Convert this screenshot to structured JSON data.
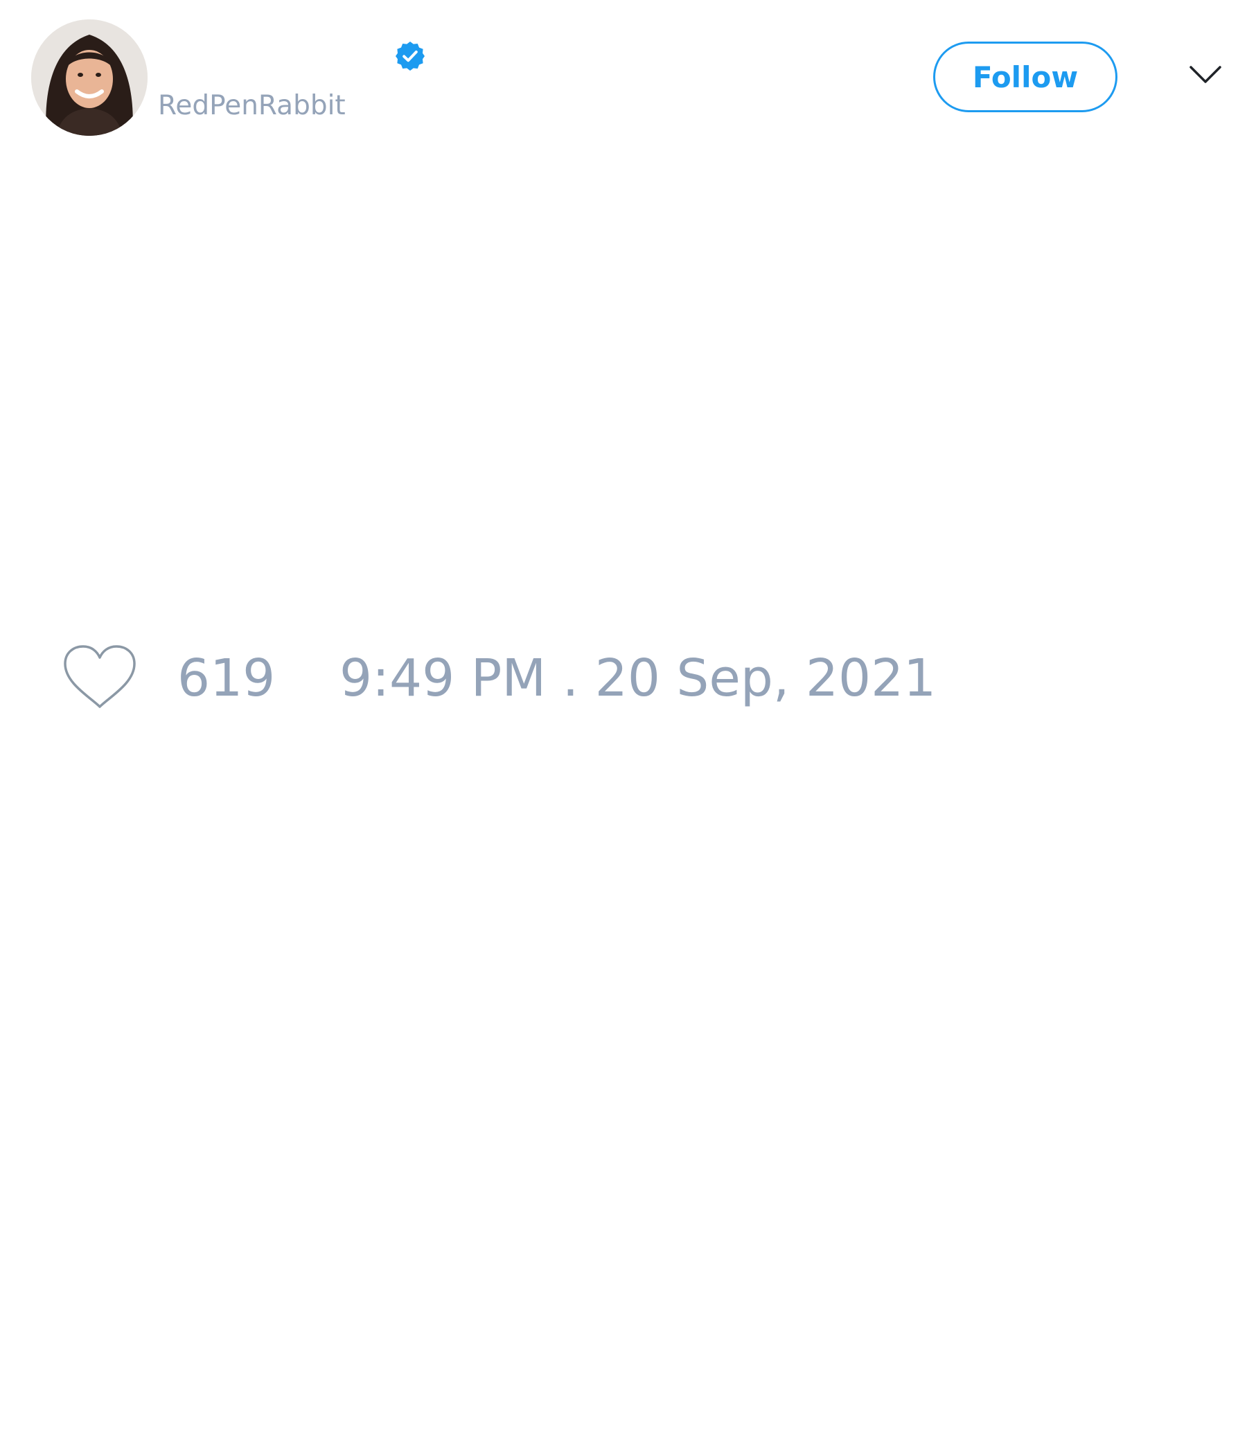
{
  "user": {
    "handle": "RedPenRabbit",
    "verified": true,
    "avatar_icon": "profile-photo"
  },
  "actions": {
    "follow_label": "Follow",
    "menu_icon": "chevron-down-icon"
  },
  "stats": {
    "like_icon": "heart-outline-icon",
    "likes": "619",
    "timestamp": "9:49 PM . 20 Sep, 2021"
  },
  "colors": {
    "accent": "#1d9bf0",
    "muted_text": "#94a3b8",
    "background": "#ffffff"
  }
}
